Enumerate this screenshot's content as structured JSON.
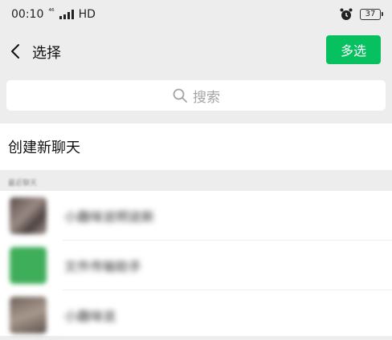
{
  "status_bar": {
    "time": "00:10",
    "network": "⁴⁶",
    "network_type": "HD",
    "battery": "37",
    "alarm_icon": "alarm-clock-icon",
    "signal_icon": "signal-bars-icon"
  },
  "header": {
    "back_icon": "chevron-left-icon",
    "title": "选择",
    "multi_select_label": "多选"
  },
  "search": {
    "icon": "search-icon",
    "placeholder": "搜索"
  },
  "new_chat": {
    "label": "创建新聊天"
  },
  "recent_section": {
    "label": "最近聊天"
  },
  "recent_chats": [
    {
      "name": "小趣味说明说新",
      "avatar_color": "#7a6a68"
    },
    {
      "name": "文件传输助手",
      "avatar_color": "#3fae5a"
    },
    {
      "name": "小趣味说",
      "avatar_color": "#8a7d74"
    }
  ],
  "colors": {
    "accent": "#07c160",
    "background": "#ededed",
    "surface": "#ffffff"
  }
}
